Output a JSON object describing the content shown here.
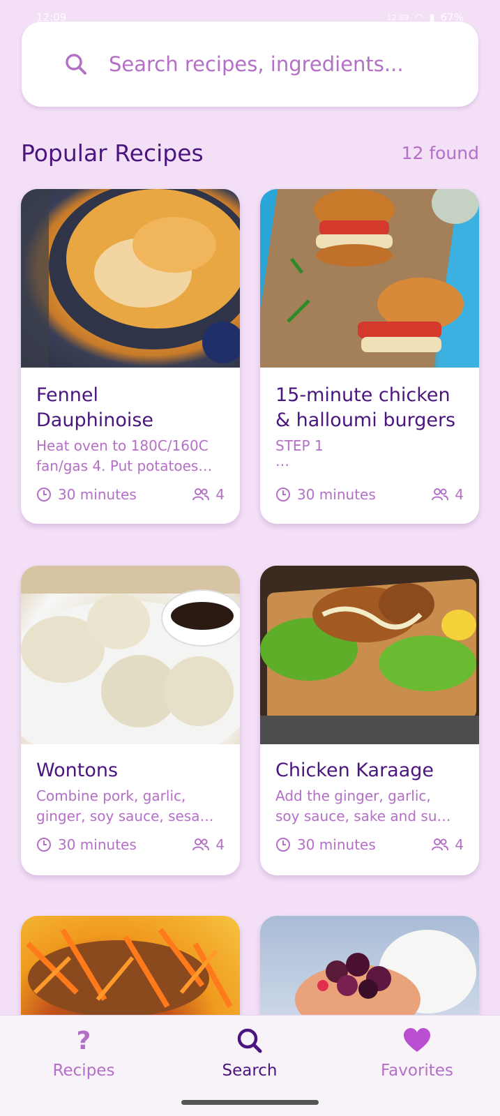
{
  "status_bar": {
    "time": "12:09",
    "battery": "67%",
    "mini_info": "12.89"
  },
  "search": {
    "placeholder": "Search recipes, ingredients..."
  },
  "section": {
    "title": "Popular Recipes",
    "count": "12 found"
  },
  "recipes": [
    {
      "title_line1": "Fennel",
      "title_line2": "Dauphinoise",
      "desc_line1": "Heat oven to 180C/160C",
      "desc_line2": "fan/gas 4. Put potatoes…",
      "time": "30 minutes",
      "servings": "4"
    },
    {
      "title_line1": "15-minute chicken",
      "title_line2": "& halloumi burgers",
      "desc_line1": "STEP 1",
      "desc_line2": "…",
      "time": "30 minutes",
      "servings": "4"
    },
    {
      "title_line1": "Wontons",
      "desc_line1": "Combine pork, garlic,",
      "desc_line2": "ginger, soy sauce, sesa…",
      "time": "30 minutes",
      "servings": "4"
    },
    {
      "title_line1": "Chicken Karaage",
      "desc_line1": "Add the ginger, garlic,",
      "desc_line2": "soy sauce, sake and su…",
      "time": "30 minutes",
      "servings": "4"
    }
  ],
  "nav": {
    "recipes": {
      "label": "Recipes",
      "icon": "?"
    },
    "search": {
      "label": "Search"
    },
    "favorites": {
      "label": "Favorites"
    }
  },
  "colors": {
    "accent": "#b46fc6",
    "primary": "#4b1580",
    "background": "#f3e0f6"
  }
}
